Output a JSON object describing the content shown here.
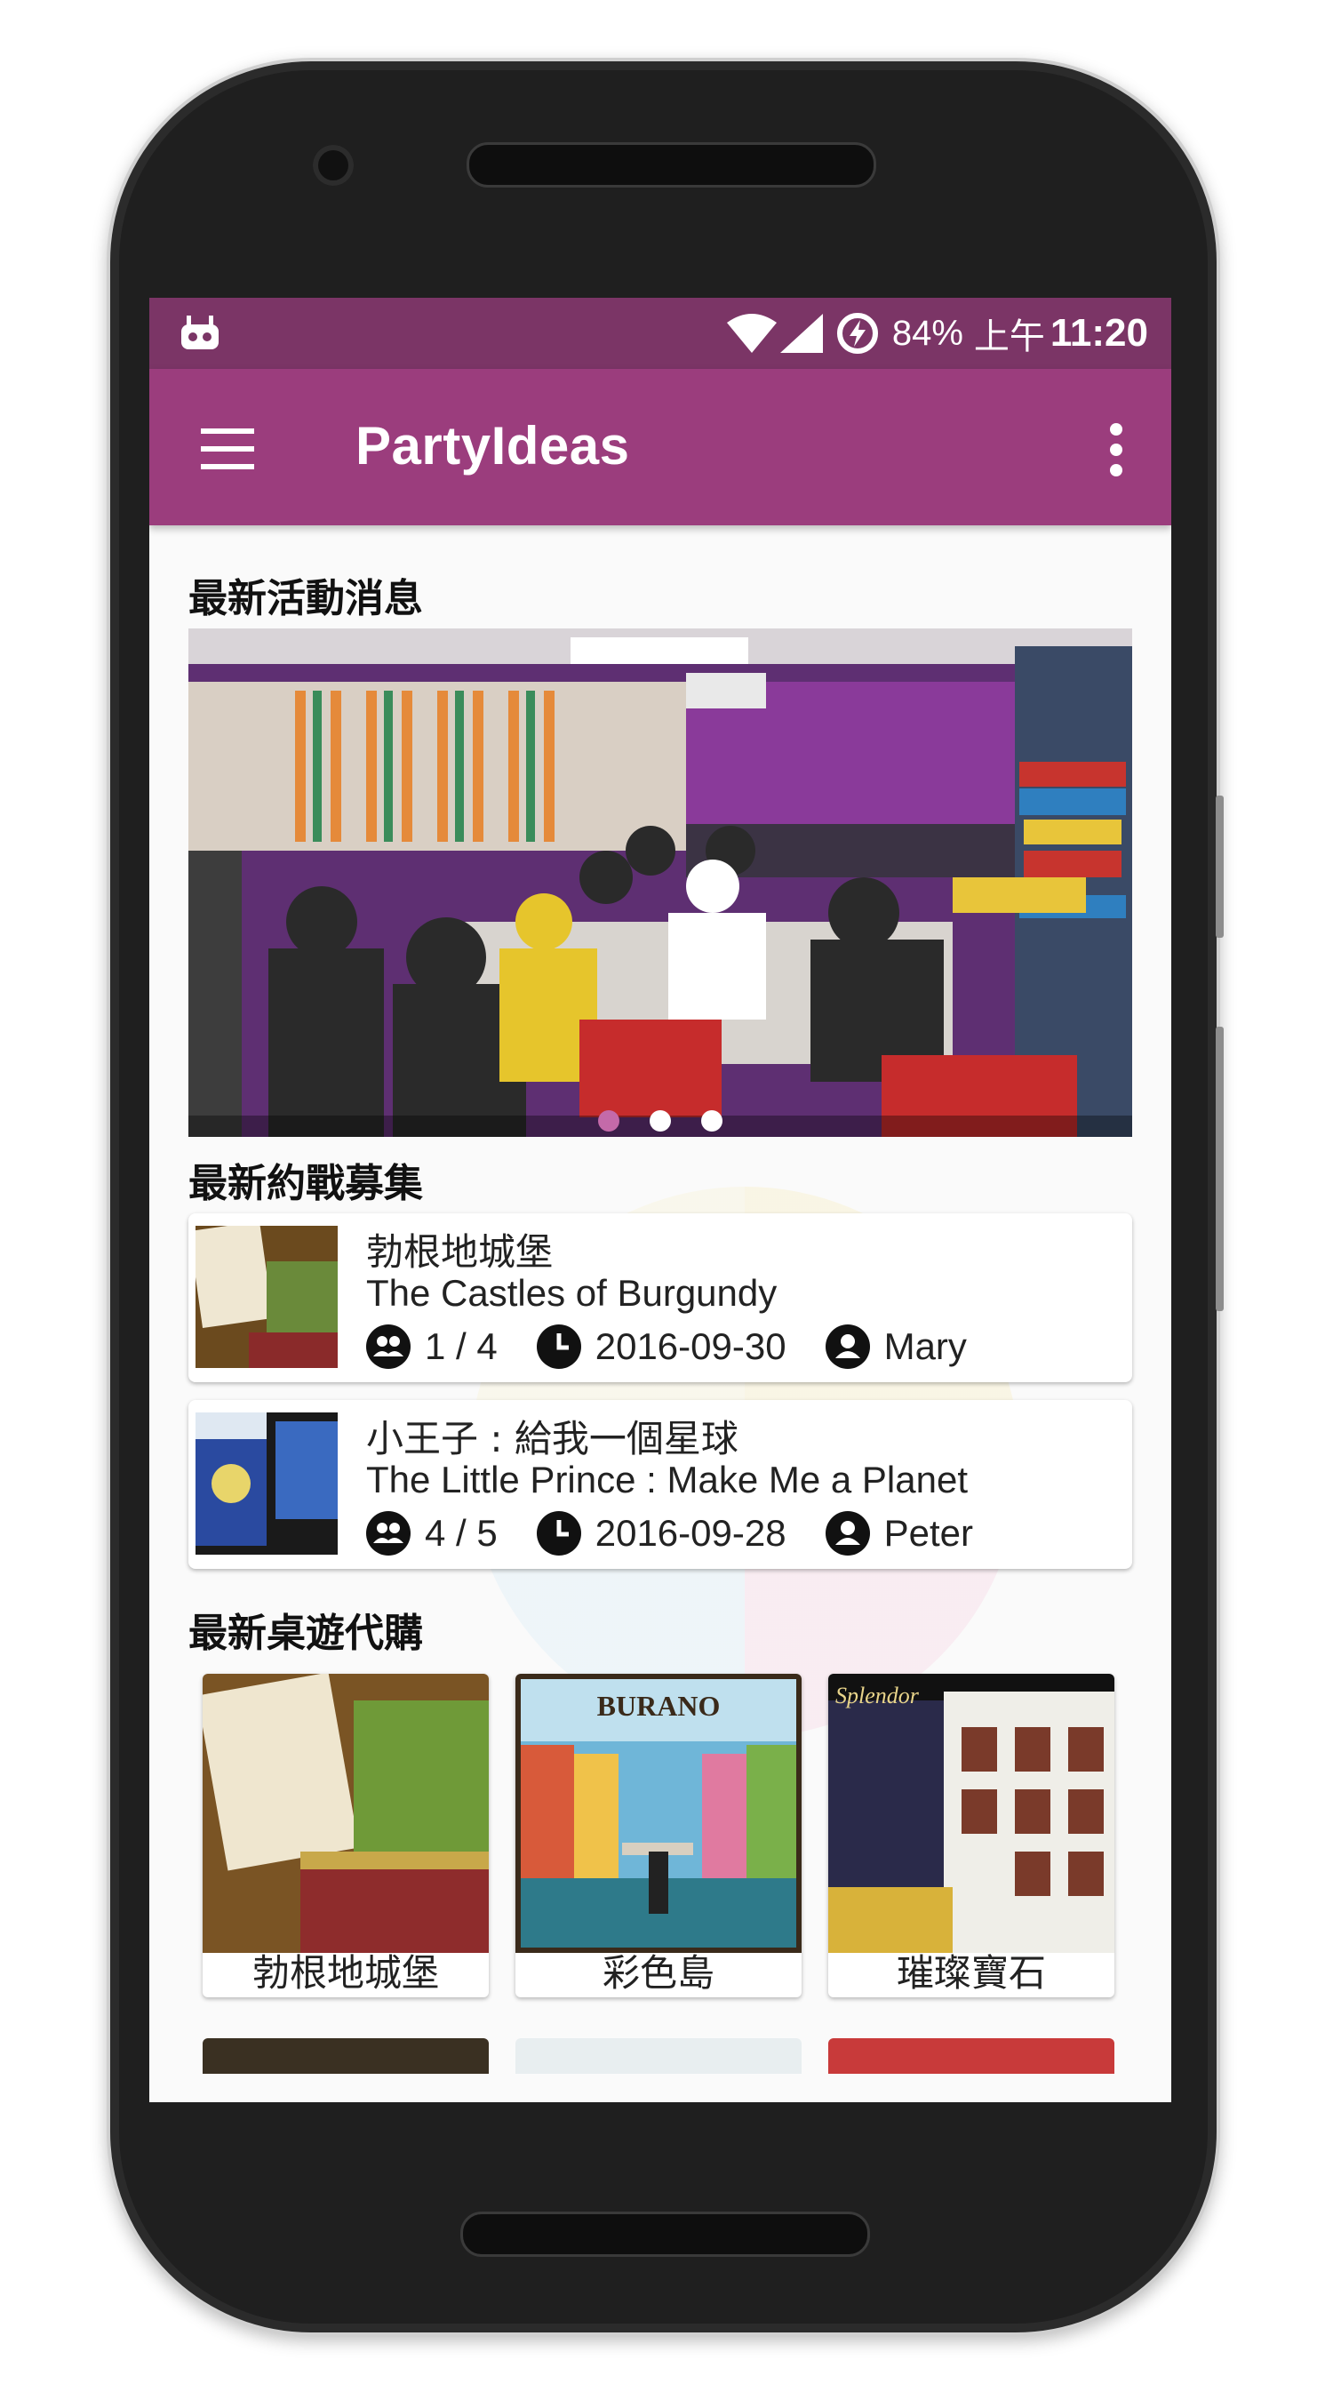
{
  "status_bar": {
    "battery": "84%",
    "time_prefix": "上午",
    "time": "11:20"
  },
  "app_bar": {
    "title": "PartyIdeas",
    "menu_icon": "hamburger-menu-icon",
    "more_icon": "more-vert-icon"
  },
  "sections": {
    "news_title": "最新活動消息",
    "recruit_title": "最新約戰募集",
    "shop_title": "最新桌遊代購"
  },
  "banner": {
    "image": "party-photo-happy-birthday",
    "pages": 3,
    "active_page": 1
  },
  "recruit_list": [
    {
      "title_zh": "勃根地城堡",
      "title_en": "The Castles of Burgundy",
      "players": "1 / 4",
      "date": "2016-09-30",
      "host": "Mary"
    },
    {
      "title_zh": "小王子 : 給我一個星球",
      "title_en": "The Little Prince : Make Me a Planet",
      "players": "4 / 5",
      "date": "2016-09-28",
      "host": "Peter"
    }
  ],
  "shop_items": [
    {
      "label": "勃根地城堡"
    },
    {
      "label": "彩色島",
      "box_title": "BURANO"
    },
    {
      "label": "璀璨寶石",
      "box_title": "Splendor"
    }
  ],
  "colors": {
    "status_bar": "#7b3566",
    "app_bar": "#9b3d7d",
    "accent_dot": "#c46aa9"
  }
}
